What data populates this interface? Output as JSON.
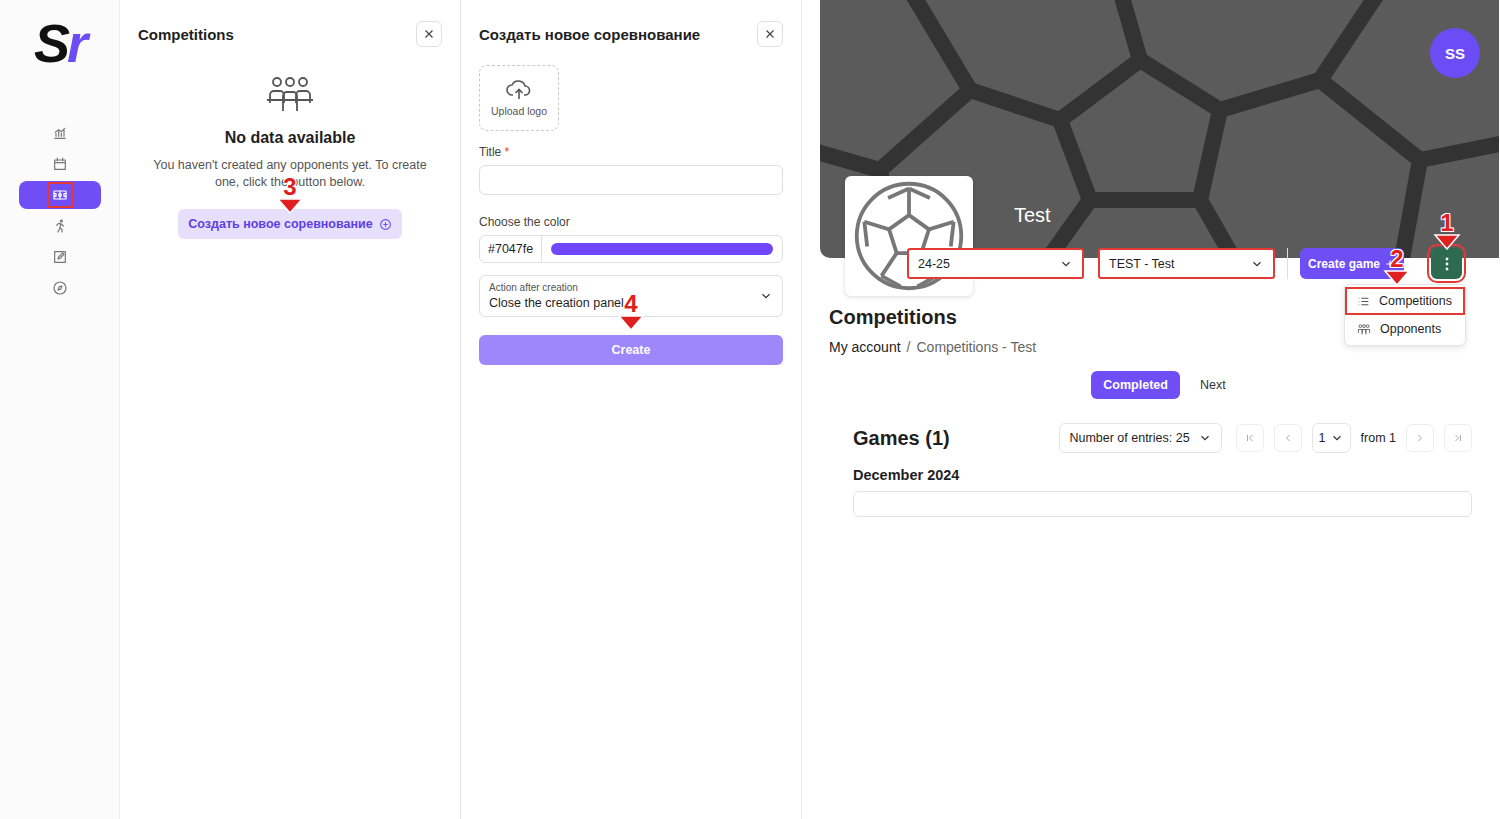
{
  "logo": {
    "first": "S",
    "second": "r"
  },
  "sidebar": {
    "items": [
      {
        "selected": false,
        "annotated": false
      },
      {
        "selected": false,
        "annotated": false
      },
      {
        "selected": true,
        "annotated": true
      },
      {
        "selected": false,
        "annotated": false
      },
      {
        "selected": false,
        "annotated": false
      },
      {
        "selected": false,
        "annotated": false
      }
    ]
  },
  "competitions_panel": {
    "title": "Competitions",
    "empty_title": "No data available",
    "empty_text": "You haven't created any opponents yet. To create one, click the button below.",
    "button": "Создать новое соревнование",
    "marker": "3"
  },
  "create_panel": {
    "title": "Создать новое соревнование",
    "upload": "Upload logo",
    "title_label": "Title",
    "required": "*",
    "title_value": "",
    "color_label": "Choose the color",
    "color_value": "#7047fe",
    "color": "#7047fe",
    "action_label": "Action after creation",
    "action_value": "Close the creation panel",
    "submit": "Create",
    "submit_disabled": true,
    "marker": "4"
  },
  "header": {
    "avatar": "SS",
    "team": "Test",
    "season": {
      "value": "24-25",
      "annotated": true
    },
    "team_select": {
      "value": "TEST - Test",
      "annotated": true
    },
    "create_game": "Create game",
    "more": {
      "annotated": true,
      "marker": "1"
    },
    "menu": {
      "open": true,
      "items": [
        {
          "label": "Competitions",
          "annotated": true,
          "marker": "2"
        },
        {
          "label": "Opponents",
          "annotated": false,
          "marker": ""
        }
      ]
    }
  },
  "page": {
    "title": "Competitions",
    "breadcrumb": [
      "My account",
      "Competitions - Test"
    ],
    "separator": "/",
    "tabs": [
      {
        "label": "Completed",
        "selected": true
      },
      {
        "label": "Next",
        "selected": false
      }
    ],
    "games": {
      "title": "Games (1)",
      "entries": "Number of entries: 25",
      "page": "1",
      "of": "from 1",
      "month": "December 2024"
    }
  }
}
